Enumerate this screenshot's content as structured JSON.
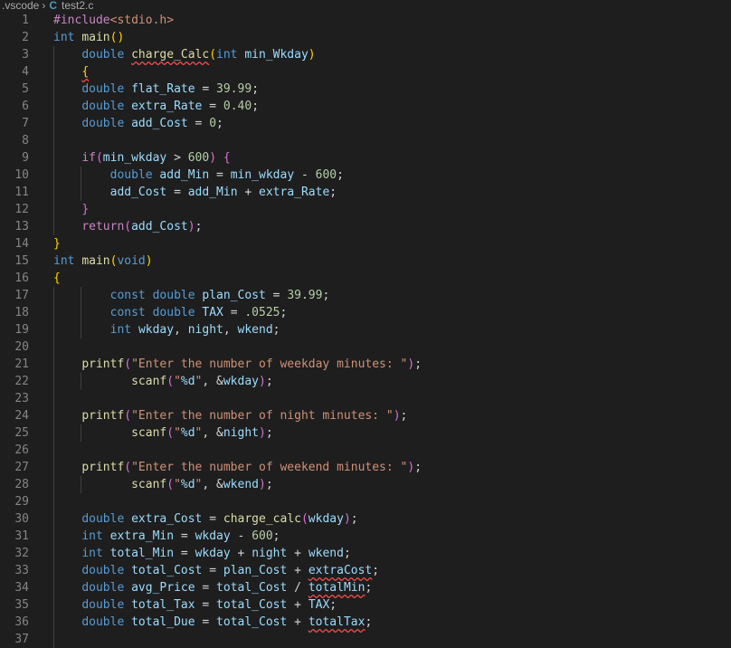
{
  "breadcrumb": {
    "folder": ".vscode",
    "file_icon": "C",
    "file": "test2.c"
  },
  "editor": {
    "line_numbers": [
      "1",
      "2",
      "3",
      "4",
      "5",
      "6",
      "7",
      "8",
      "9",
      "10",
      "11",
      "12",
      "13",
      "14",
      "15",
      "16",
      "17",
      "18",
      "19",
      "20",
      "21",
      "22",
      "23",
      "24",
      "25",
      "26",
      "27",
      "28",
      "29",
      "30",
      "31",
      "32",
      "33",
      "34",
      "35",
      "36",
      "37"
    ],
    "lines": [
      "#include<stdio.h>",
      "int main()",
      "    double charge_Calc(int min_Wkday)",
      "    {",
      "    double flat_Rate = 39.99;",
      "    double extra_Rate = 0.40;",
      "    double add_Cost = 0;",
      "",
      "    if(min_wkday > 600) {",
      "        double add_Min = min_wkday - 600;",
      "        add_Cost = add_Min + extra_Rate;",
      "    }",
      "    return(add_Cost);",
      "}",
      "int main(void)",
      "{",
      "        const double plan_Cost = 39.99;",
      "        const double TAX = .0525;",
      "        int wkday, night, wkend;",
      "",
      "    printf(\"Enter the number of weekday minutes: \");",
      "            scanf(\"%d\", &wkday);",
      "",
      "    printf(\"Enter the number of night minutes: \");",
      "            scanf(\"%d\", &night);",
      "",
      "    printf(\"Enter the number of weekend minutes: \");",
      "            scanf(\"%d\", &wkend);",
      "",
      "    double extra_Cost = charge_calc(wkday);",
      "    int extra_Min = wkday - 600;",
      "    int total_Min = wkday + night + wkend;",
      "    double total_Cost = plan_Cost + extraCost;",
      "    double avg_Price = total_Cost / totalMin;",
      "    double total_Tax = total_Cost + TAX;",
      "    double total_Due = total_Cost + totalTax;",
      ""
    ]
  },
  "colors": {
    "background": "#1e1e1e",
    "keyword": "#569cd6",
    "function": "#dcdcaa",
    "variable": "#9cdcfe",
    "number": "#b5cea8",
    "string": "#ce9178",
    "control": "#c586c0",
    "error_squiggle": "#f14c4c"
  }
}
